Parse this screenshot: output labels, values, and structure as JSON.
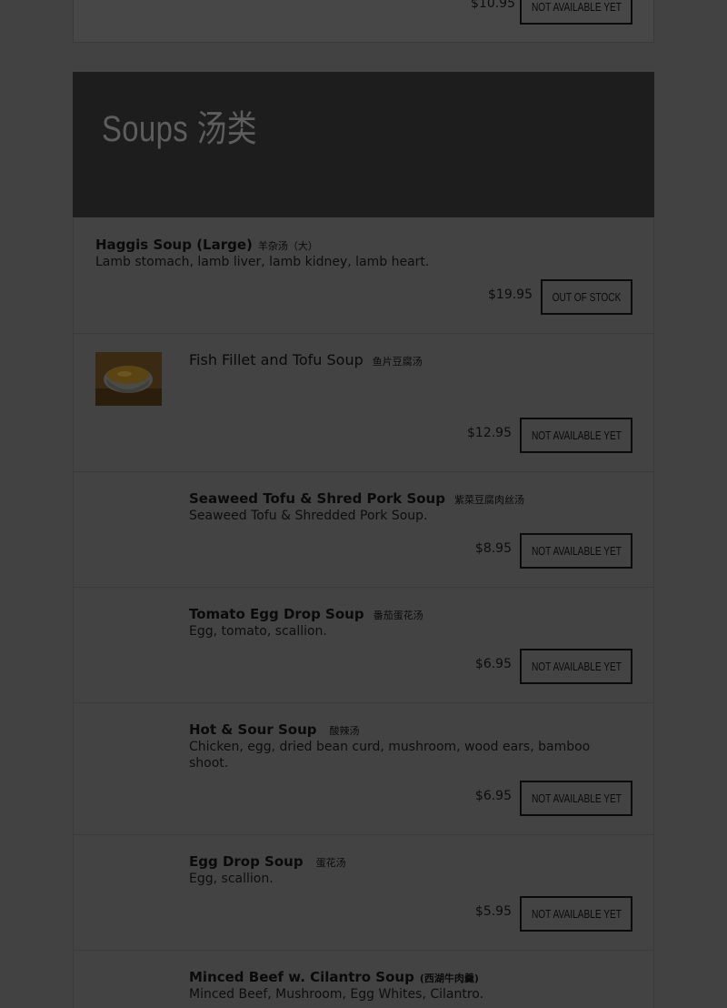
{
  "prev_item": {
    "price": "$10.95",
    "button": "Not Available Yet"
  },
  "section": {
    "title": "Soups 汤类"
  },
  "items": [
    {
      "name": "Haggis Soup (Large)",
      "cn": "羊杂汤（大）",
      "desc": "Lamb stomach, lamb liver, lamb kidney, lamb heart.",
      "price": "$19.95",
      "button": "Out of stock"
    },
    {
      "name": "Fish Fillet and Tofu Soup",
      "cn": "鱼片豆腐汤",
      "desc": "",
      "price": "$12.95",
      "button": "Not Available Yet",
      "thumb_icon": "soup-bowl-photo"
    },
    {
      "name": "Seaweed Tofu & Shred Pork Soup",
      "cn": "紫菜豆腐肉丝汤",
      "desc": "Seaweed Tofu & Shredded Pork Soup.",
      "price": "$8.95",
      "button": "Not Available Yet"
    },
    {
      "name": "Tomato Egg Drop Soup",
      "cn": "番茄蛋花汤",
      "desc": "Egg, tomato, scallion.",
      "price": "$6.95",
      "button": "Not Available Yet"
    },
    {
      "name": "Hot & Sour Soup",
      "cn": "酸辣汤",
      "desc": "Chicken, egg, dried bean curd, mushroom, wood ears, bamboo shoot.",
      "price": "$6.95",
      "button": "Not Available Yet"
    },
    {
      "name": "Egg Drop Soup",
      "cn": "蛋花汤",
      "desc": "Egg, scallion.",
      "price": "$5.95",
      "button": "Not Available Yet"
    },
    {
      "name": "Minced Beef w. Cilantro Soup",
      "cn": "(西湖牛肉羹)",
      "desc": "Minced Beef, Mushroom, Egg Whites, Cilantro.",
      "price": "",
      "button": ""
    }
  ]
}
